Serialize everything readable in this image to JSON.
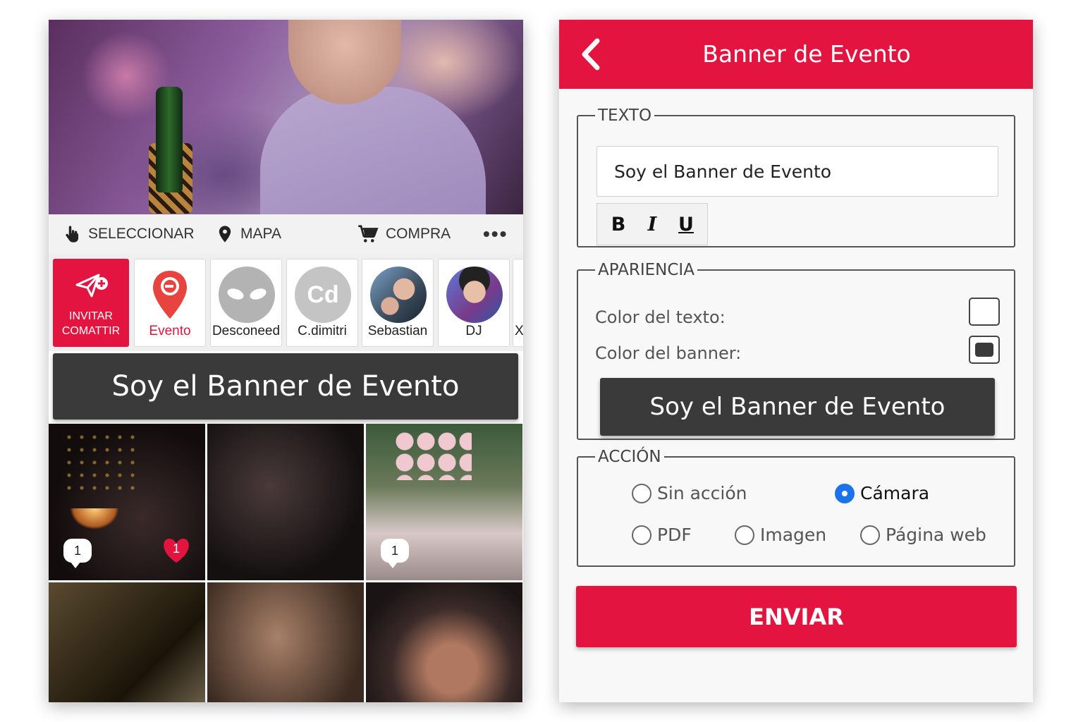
{
  "left_screen": {
    "actions": {
      "select_label": "SELECCIONAR",
      "map_label": "MAPA",
      "buy_label": "COMPRA",
      "more_label": "•••"
    },
    "contacts": [
      {
        "name": "INVITAR COMATTIR",
        "type": "invite"
      },
      {
        "name": "Evento",
        "type": "event"
      },
      {
        "name": "Desconeed",
        "type": "unknown"
      },
      {
        "name": "C.dimitri",
        "type": "initials",
        "initials": "Cd"
      },
      {
        "name": "Sebastian",
        "type": "photo"
      },
      {
        "name": "DJ",
        "type": "photo"
      },
      {
        "name": "X",
        "type": "partial"
      }
    ],
    "banner_text": "Soy el Banner de Evento",
    "photo_badges": {
      "tile1_comments": "1",
      "tile1_likes": "1",
      "tile3_comments": "1"
    }
  },
  "right_screen": {
    "header": {
      "title": "Banner de Evento"
    },
    "text_group": {
      "legend": "TEXTO",
      "input_value": "Soy el Banner de Evento",
      "bold": "B",
      "italic": "I",
      "underline": "U"
    },
    "appearance_group": {
      "legend": "APARIENCIA",
      "text_color_label": "Color del texto:",
      "banner_color_label": "Color del banner:",
      "preview_text": "Soy el Banner de Evento"
    },
    "action_group": {
      "legend": "ACCIÓN",
      "options": [
        "Sin acción",
        "Cámara",
        "PDF",
        "Imagen",
        "Página web"
      ],
      "selected": "Cámara"
    },
    "submit_label": "ENVIAR"
  },
  "colors": {
    "accent": "#e3143f",
    "banner_bg": "#3a3a3a",
    "radio_selected": "#1a73e8"
  }
}
